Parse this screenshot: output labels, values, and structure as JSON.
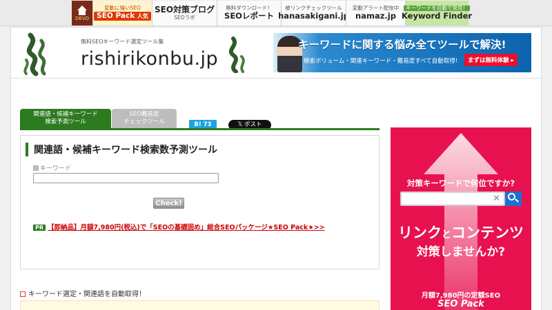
{
  "topbar": {
    "items": [
      {
        "small": "",
        "big": "",
        "home_label": "DEVO"
      },
      {
        "small": "変動に強いSEO",
        "big": "SEO Pack",
        "badge": "人気"
      },
      {
        "small": "",
        "big": "SEO対策ブログ",
        "sub": "SEOラボ"
      },
      {
        "small": "無料ダウンロード！",
        "big": "SEOレポート"
      },
      {
        "small": "被リンクチェックツール",
        "big": "hanasakigani.jp"
      },
      {
        "small": "変動アラート配信中",
        "big": "namaz.jp"
      },
      {
        "small": "キーワードを自動で発見！",
        "big": "Keyword Finder"
      }
    ]
  },
  "header": {
    "logo_sub": "無料SEOキーワード選定ツール集",
    "logo_main": "rishirikonbu.jp",
    "banner": {
      "title": "キーワードに関する悩み全てツールで解決!",
      "subtitle": "検索ボリューム・関連キーワード・難易度すべて自動取得!",
      "cta": "まずは無料体験 ▸"
    }
  },
  "tabs": {
    "active_line1": "関連語・候補キーワード",
    "active_line2": "検索予測ツール",
    "inactive_line1": "SEO難易度",
    "inactive_line2": "チェックツール"
  },
  "social": {
    "hatena": "B! 73",
    "x_post": "𝕏 ポスト"
  },
  "tool": {
    "title": "関連語・候補キーワード検索数予測ツール",
    "keyword_label": "キーワード",
    "keyword_value": "",
    "check_button": "Check!",
    "pr_badge": "PR",
    "pr_link": "【即納品】月額7,980円(税込)で「SEOの基礎固め」総合SEOパッケージ★SEO Pack★>>"
  },
  "note": {
    "text": "キーワード選定・関連語を自動取得！"
  },
  "ad": {
    "question": "対策キーワードで何位ですか?",
    "big1_a": "リンク",
    "big1_b": "と",
    "big1_c": "コンテンツ",
    "big2": "対策しませんか?",
    "price": "月額7,980円の定額SEO",
    "pack": "SEO Pack"
  },
  "colors": {
    "brand_green": "#2d7a1f",
    "ad_pink": "#e8114f",
    "pr_red": "#cc0000",
    "hatena_blue": "#1da3e0"
  }
}
